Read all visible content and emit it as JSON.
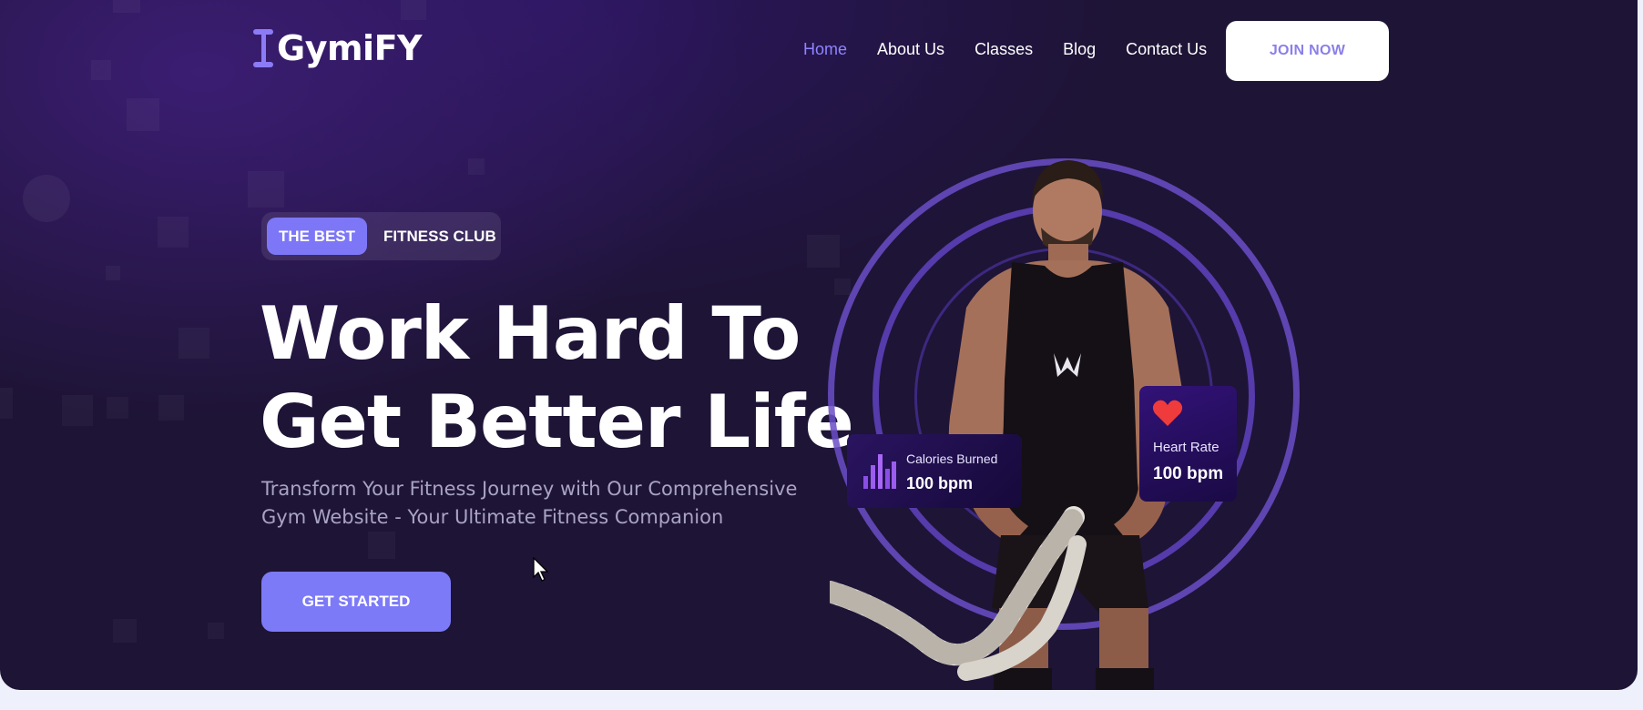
{
  "brand": {
    "name": "GymiFY",
    "accent": "#8b7bf6"
  },
  "nav": {
    "items": [
      {
        "label": "Home",
        "active": true
      },
      {
        "label": "About Us",
        "active": false
      },
      {
        "label": "Classes",
        "active": false
      },
      {
        "label": "Blog",
        "active": false
      },
      {
        "label": "Contact Us",
        "active": false
      }
    ],
    "cta": "JOIN NOW"
  },
  "hero": {
    "badge_highlight": "THE BEST",
    "badge_rest": "FITNESS CLUB",
    "headline_line1": "Work Hard To",
    "headline_line2": "Get Better Life",
    "subtitle": "Transform Your Fitness Journey with Our Comprehensive Gym Website - Your Ultimate Fitness Companion",
    "cta": "GET STARTED"
  },
  "stats": {
    "calories": {
      "label": "Calories Burned",
      "value": "100 bpm",
      "icon": "bar-chart-icon"
    },
    "heart_rate": {
      "label": "Heart Rate",
      "value": "100 bpm",
      "icon": "heart-icon"
    }
  },
  "colors": {
    "background": "#1e1436",
    "primary_button": "#7d7af8",
    "nav_active": "#8f84ff",
    "heart": "#ef3b3b",
    "ring": "#6a4ec7"
  }
}
